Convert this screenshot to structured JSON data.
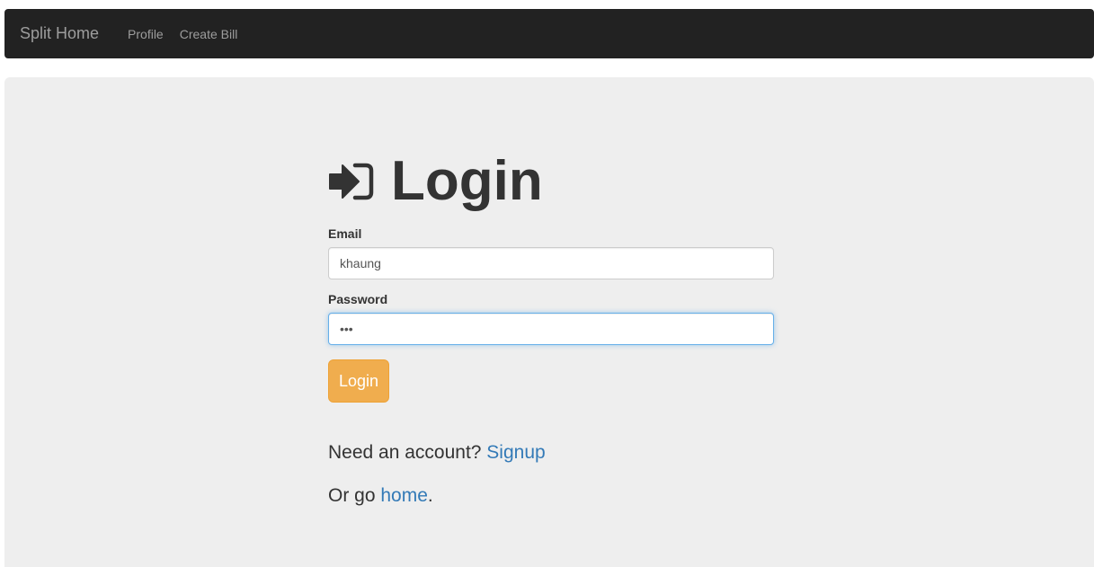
{
  "navbar": {
    "brand": "Split Home",
    "links": [
      {
        "label": "Profile"
      },
      {
        "label": "Create Bill"
      }
    ]
  },
  "login": {
    "title": "Login",
    "icon": "sign-in-icon",
    "email_label": "Email",
    "email_value": "khaung",
    "password_label": "Password",
    "password_value": "•••",
    "submit_label": "Login"
  },
  "footer_links": {
    "signup_prefix": "Need an account? ",
    "signup_link": "Signup",
    "home_prefix": "Or go ",
    "home_link": "home",
    "home_suffix": "."
  },
  "colors": {
    "navbar_bg": "#222222",
    "jumbotron_bg": "#eeeeee",
    "button_warning": "#f0ad4e",
    "link": "#337ab7",
    "focus_border": "#66afe9"
  }
}
